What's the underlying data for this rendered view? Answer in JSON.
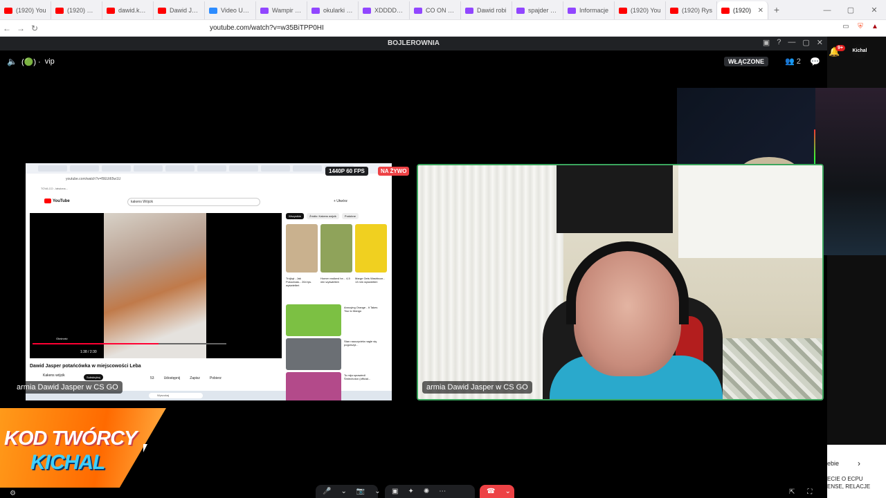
{
  "browser": {
    "tabs": [
      {
        "label": "(1920) You",
        "color": "#ff0000"
      },
      {
        "label": "(1920) Miki",
        "color": "#ff0000"
      },
      {
        "label": "dawid.kami",
        "color": "#ff0000"
      },
      {
        "label": "Dawid Jasp",
        "color": "#ff0000"
      },
      {
        "label": "Video Unav",
        "color": "#2d8cff"
      },
      {
        "label": "Wampir wa",
        "color": "#9146ff"
      },
      {
        "label": "okularki - T",
        "color": "#9146ff"
      },
      {
        "label": "XDDDDDDD",
        "color": "#9146ff"
      },
      {
        "label": "CO ON PO",
        "color": "#9146ff"
      },
      {
        "label": "Dawid robi",
        "color": "#9146ff"
      },
      {
        "label": "spajder ma",
        "color": "#9146ff"
      },
      {
        "label": "Informacje",
        "color": "#9146ff"
      },
      {
        "label": "(1920) You",
        "color": "#ff0000"
      },
      {
        "label": "(1920) Rys",
        "color": "#ff0000"
      },
      {
        "label": "(1920)",
        "color": "#ff0000"
      }
    ],
    "new_tab": "+",
    "url": "youtube.com/watch?v=w35BiTPP0HI"
  },
  "discord": {
    "server_title": "BOJLEROWNIA",
    "channel_icon": "speaker-icon",
    "channel_name": "vip",
    "channel_emoji": "(🟢) ·",
    "status_button": "WŁĄCZONE",
    "people_count": "2",
    "notif_badge": "9+",
    "avatar_text": "Kichal",
    "share_label": "armia Dawid Jasper w CS GO",
    "cam_label": "armia Dawid Jasper w CS GO",
    "quality_badge": "1440P 60 FPS",
    "live_badge": "NA ŻYWO"
  },
  "shared_screen": {
    "url": "youtube.com/watch?v=f9EUt65w1U",
    "bookmark": "TOVA.CO - łatwizna...",
    "search_query": "kakens Wójcik",
    "create_label": "+ Utwórz",
    "video_title": "Dawid Jasper potańcówka w miejscowości Leba",
    "channel": "Kakens wójcik",
    "subscribe": "Subskrybuj",
    "likes": "53",
    "share_btn": "Udostępnij",
    "save_btn": "Zapisz",
    "download_btn": "Pobierz",
    "time": "1:38 / 2:30",
    "progress": 0.65,
    "volume_tooltip": "Głośność",
    "chips": [
      "Wszystkie",
      "Źródło: Kakens wójcik",
      "Podobne"
    ],
    "shorts": [
      {
        "title": "Trójkąt - Jak Pokochała...",
        "views": "264 tys. wyświetleń",
        "color": "#c9b18e"
      },
      {
        "title": "Homer realized he...",
        "views": "4,5 mln wyświetleń",
        "color": "#8fa35a"
      },
      {
        "title": "Marge Gets Washboar...",
        "views": "13 mln wyświetleń",
        "color": "#f0d020"
      }
    ],
    "recs": [
      {
        "title": "Annoying Orange - It Takes Two to Mango",
        "color": "#7cc043"
      },
      {
        "title": "Stan nauczyciela nagle się pogorszył...",
        "color": "#6b6f74"
      },
      {
        "title": "To mija sprawiedl Śmiechoton (official...",
        "color": "#b34a8a"
      }
    ],
    "taskbar_search": "Wyszukaj"
  },
  "overlay": {
    "creator_line1": "KOD TWÓRCY",
    "creator_line2": "KICHAL"
  },
  "sidebar_right": {
    "card_text": "ebie",
    "card_text2": "ECIE O ECPU\nENSE, RELACJE"
  }
}
